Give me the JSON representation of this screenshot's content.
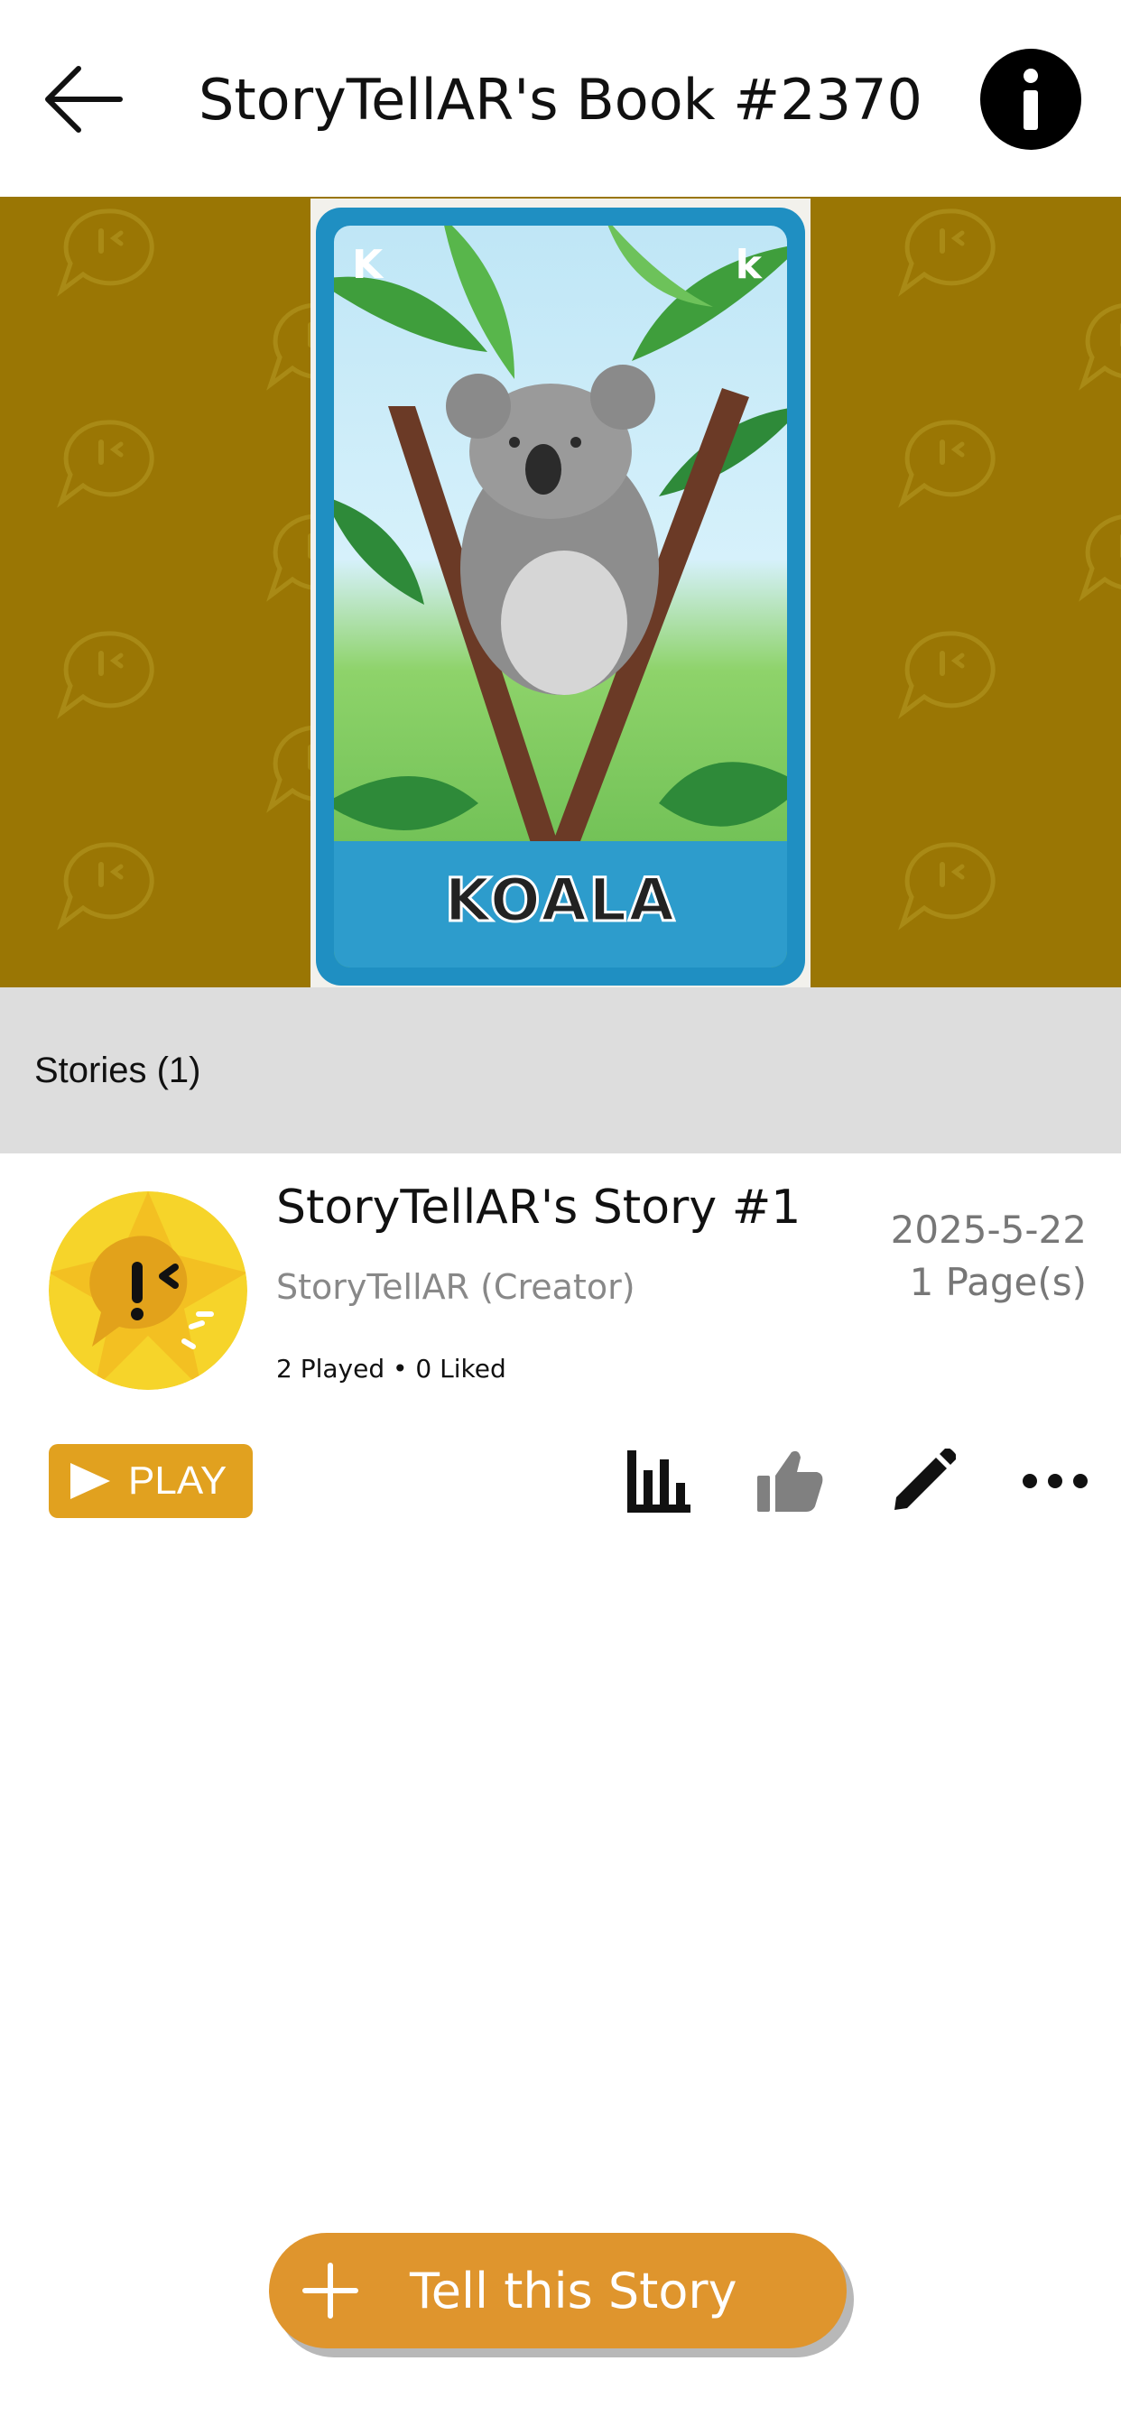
{
  "header": {
    "title": "StoryTellAR's Book #2370",
    "back_icon": "arrow-left-icon",
    "info_icon": "info-icon"
  },
  "hero": {
    "background_color": "#9a7604",
    "card_letter_upper": "K",
    "card_letter_lower": "k",
    "card_word": "KOALA"
  },
  "stories": {
    "header_label": "Stories (1)",
    "items": [
      {
        "title": "StoryTellAR's Story #1",
        "creator": "StoryTellAR (Creator)",
        "stats": "2 Played • 0 Liked",
        "date": "2025-5-22",
        "pages": "1 Page(s)",
        "play_label": "PLAY",
        "actions": [
          "bar-chart-icon",
          "thumbs-up-icon",
          "pencil-icon",
          "more-horizontal-icon"
        ]
      }
    ]
  },
  "fab": {
    "label": "Tell this Story",
    "icon": "plus-icon"
  },
  "colors": {
    "accent": "#e1a11f",
    "fab": "#df952d",
    "stories_bar": "#dddddd"
  }
}
